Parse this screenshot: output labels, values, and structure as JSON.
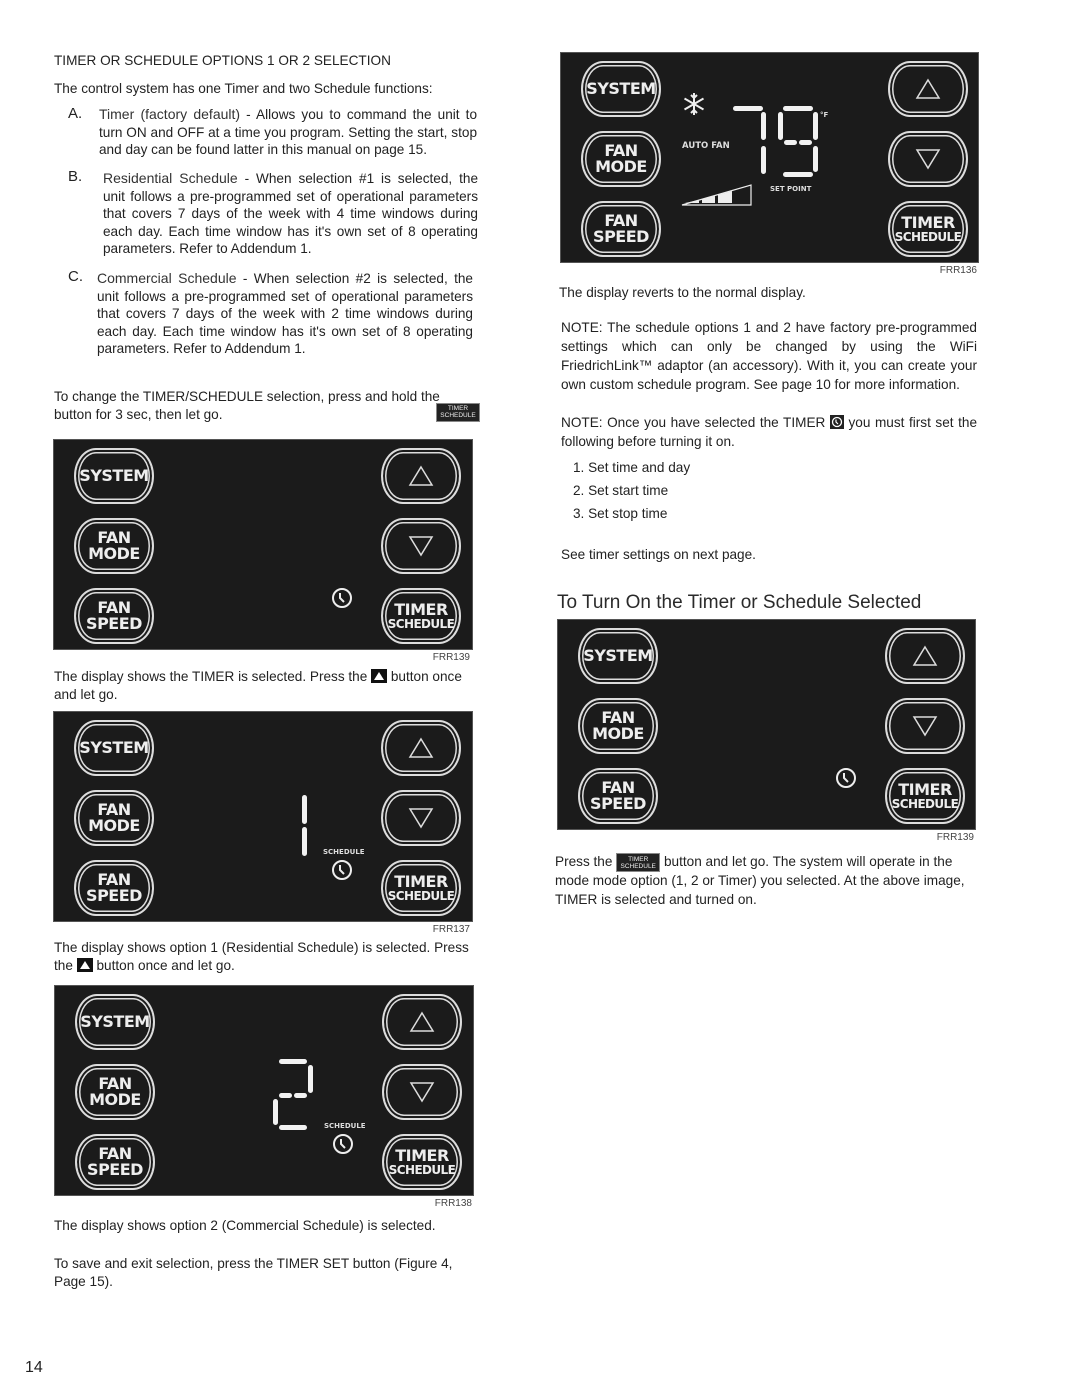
{
  "left": {
    "section_heading": "TIMER OR SCHEDULE OPTIONS 1 OR 2 SELECTION",
    "intro": "The control system has one Timer and two Schedule functions:",
    "items": [
      {
        "letter": "A.",
        "title": "Timer (factory default)",
        "text": " - Allows you to command the unit to turn ON and OFF at a time you program. Setting the start, stop and day can be found latter in this manual on page 15."
      },
      {
        "letter": "B.",
        "title": "Residential Schedule",
        "text": " - When selection #1 is selected, the unit follows a pre-programmed set of operational parameters that covers 7 days of the week with 4 time windows during each day. Each time window has it's own set of 8 operating parameters. Refer to Addendum 1."
      },
      {
        "letter": "C.",
        "title": "Commercial Schedule",
        "text": " - When selection #2 is selected, the unit follows a pre-programmed set of operational parameters that covers 7 days of the week with 2 time windows during each day. Each time window has it's own set of 8 operating parameters. Refer to Addendum 1."
      }
    ],
    "change_instr_a": "To change the TIMER/SCHEDULE selection, press and hold the ",
    "change_instr_b": "button for 3 sec, then let go.",
    "caption1_a": "The display shows the TIMER is selected. Press the ",
    "caption1_b": " button once and let go.",
    "caption2_a": "The display shows option 1 (Residential Schedule) is selected.  Press the ",
    "caption2_b": " button once and let go.",
    "caption3": "The display shows option 2 (Commercial Schedule) is selected.",
    "save_instr": "To save and exit selection, press the TIMER SET button (Figure 4, Page 15)."
  },
  "right": {
    "caption_revert": "The display reverts to the normal display.",
    "note1": "NOTE: The schedule options 1 and 2 have factory pre-programmed settings which can only be changed by using the WiFi FriedrichLink™ adaptor (an accessory). With it, you can create your own custom schedule program. See page 10 for more information.",
    "note2_a": "NOTE: Once you have selected the TIMER ",
    "note2_b": " you must first set the following before turning it on.",
    "steps": [
      "1. Set time and day",
      "2. Set start time",
      "3. Set stop time"
    ],
    "see_next": "See timer settings on next page.",
    "heading2": "To Turn On the Timer or Schedule Selected",
    "press_a": "Press the ",
    "press_b": " button and let go. The system will operate in the mode mode option (1, 2 or Timer) you selected. At the above image, TIMER is selected and turned on."
  },
  "panel_buttons": {
    "system": "SYSTEM",
    "fan": "FAN",
    "mode": "MODE",
    "speed": "SPEED",
    "timer": "TIMER",
    "schedule": "SCHEDULE"
  },
  "inline_button": {
    "top": "TIMER",
    "bottom": "SCHEDULE"
  },
  "figures": [
    {
      "id": "FRR139",
      "display": "timer clock only"
    },
    {
      "id": "FRR137",
      "display": "1",
      "label": "SCHEDULE"
    },
    {
      "id": "FRR138",
      "display": "2",
      "label": "SCHEDULE"
    },
    {
      "id": "FRR136",
      "display": "79",
      "unit": "°F",
      "mode_label": "AUTO FAN",
      "setpoint_label": "SET POINT",
      "icon": "snowflake-icon",
      "fan_level_bars": 3
    },
    {
      "id": "FRR139",
      "display": "timer clock only"
    }
  ],
  "page_number": "14"
}
